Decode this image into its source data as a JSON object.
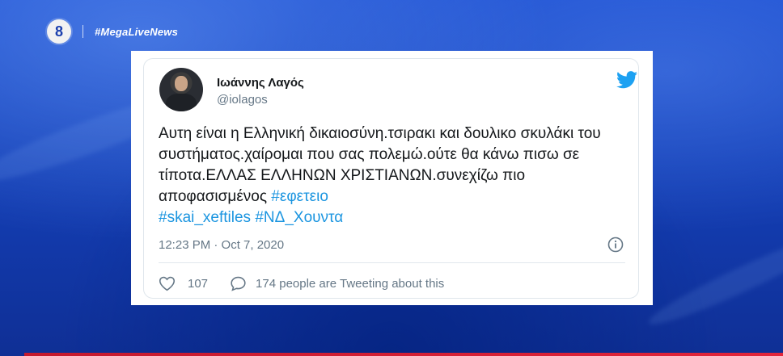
{
  "overlay": {
    "channel_number": "8",
    "hashtag": "#MegaLiveNews"
  },
  "tweet": {
    "display_name": "Ιωάννης Λαγός",
    "handle": "@iolagos",
    "text_segments": {
      "t1": "Αυτη είναι η Ελληνική δικαιοσύνη.τσιρακι και δουλικο σκυλάκι του συστήματος.χαίρομαι που σας πολεμώ.ούτε θα κάνω πισω σε τίποτα.ΕΛΛΑΣ ΕΛΛΗΝΩΝ ΧΡΙΣΤΙΑΝΩΝ.συνεχίζω πιο αποφασισμένος ",
      "h1": "#εφετειο",
      "h2": "#skai_xeftiles",
      "h3": "#ΝΔ_Χουντα"
    },
    "timestamp": "12:23 PM · Oct 7, 2020",
    "likes": "107",
    "people_tweeting": "174 people are Tweeting about this"
  },
  "icons": {
    "channel": "channel-8-logo",
    "brand": "twitter-bird-icon",
    "info": "info-icon",
    "like": "heart-icon",
    "reply": "speech-bubble-icon"
  },
  "colors": {
    "hashtag_link": "#1b95e0",
    "twitter_blue": "#1da1f2",
    "secondary_text": "#657786",
    "background_blue": "#1440b8"
  }
}
